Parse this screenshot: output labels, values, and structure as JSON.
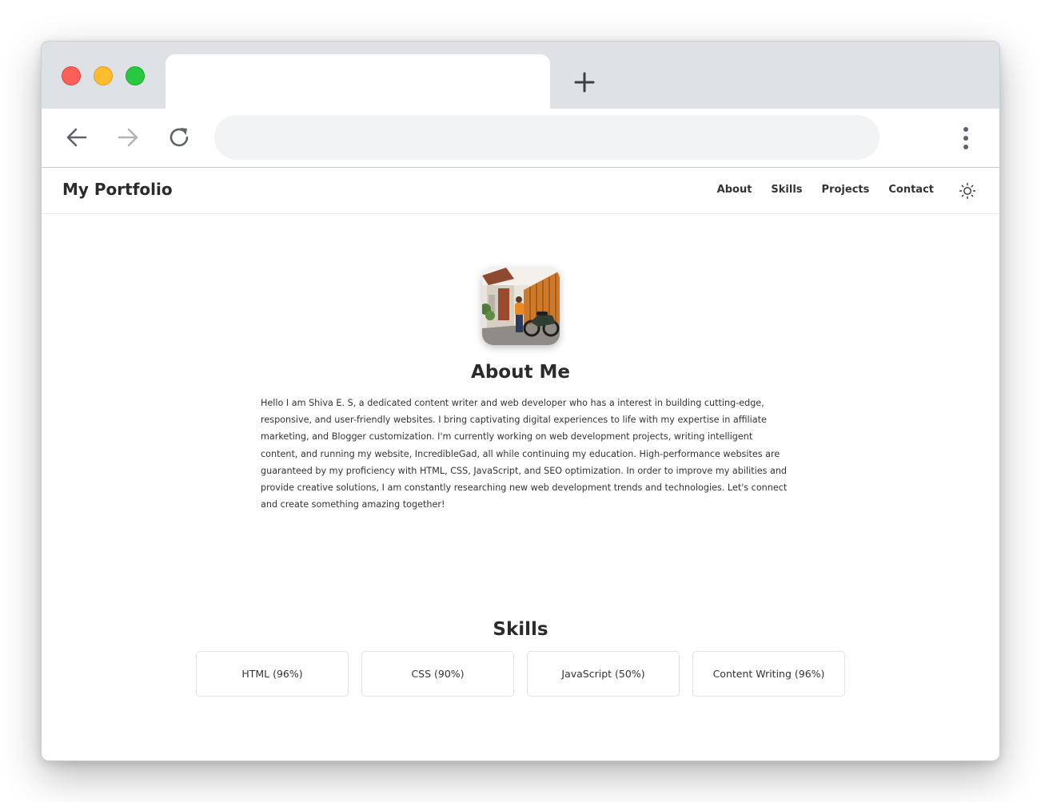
{
  "browser": {
    "new_tab_icon": "plus-icon",
    "back_icon": "arrow-left-icon",
    "forward_icon": "arrow-right-icon",
    "reload_icon": "reload-icon",
    "menu_icon": "kebab-menu-icon",
    "address": "",
    "traffic_lights": {
      "close": "#fe5f57",
      "minimize": "#febc2e",
      "maximize": "#28c840"
    }
  },
  "site": {
    "brand": "My Portfolio",
    "nav": [
      "About",
      "Skills",
      "Projects",
      "Contact"
    ],
    "theme_toggle_icon": "sun-icon"
  },
  "about": {
    "title": "About Me",
    "avatar": "profile-photo",
    "text": "Hello I am Shiva E. S, a dedicated content writer and web developer who has a interest in building cutting-edge, responsive, and user-friendly websites. I bring captivating digital experiences to life with my expertise in affiliate marketing, and Blogger customization. I'm currently working on web development projects, writing intelligent content, and running my website, IncredibleGad, all while continuing my education. High-performance websites are guaranteed by my proficiency with HTML, CSS, JavaScript, and SEO optimization. In order to improve my abilities and provide creative solutions, I am constantly researching new web development trends and technologies. Let's connect and create something amazing together!"
  },
  "skills": {
    "title": "Skills",
    "items": [
      "HTML (96%)",
      "CSS (90%)",
      "JavaScript (50%)",
      "Content Writing (96%)"
    ]
  }
}
